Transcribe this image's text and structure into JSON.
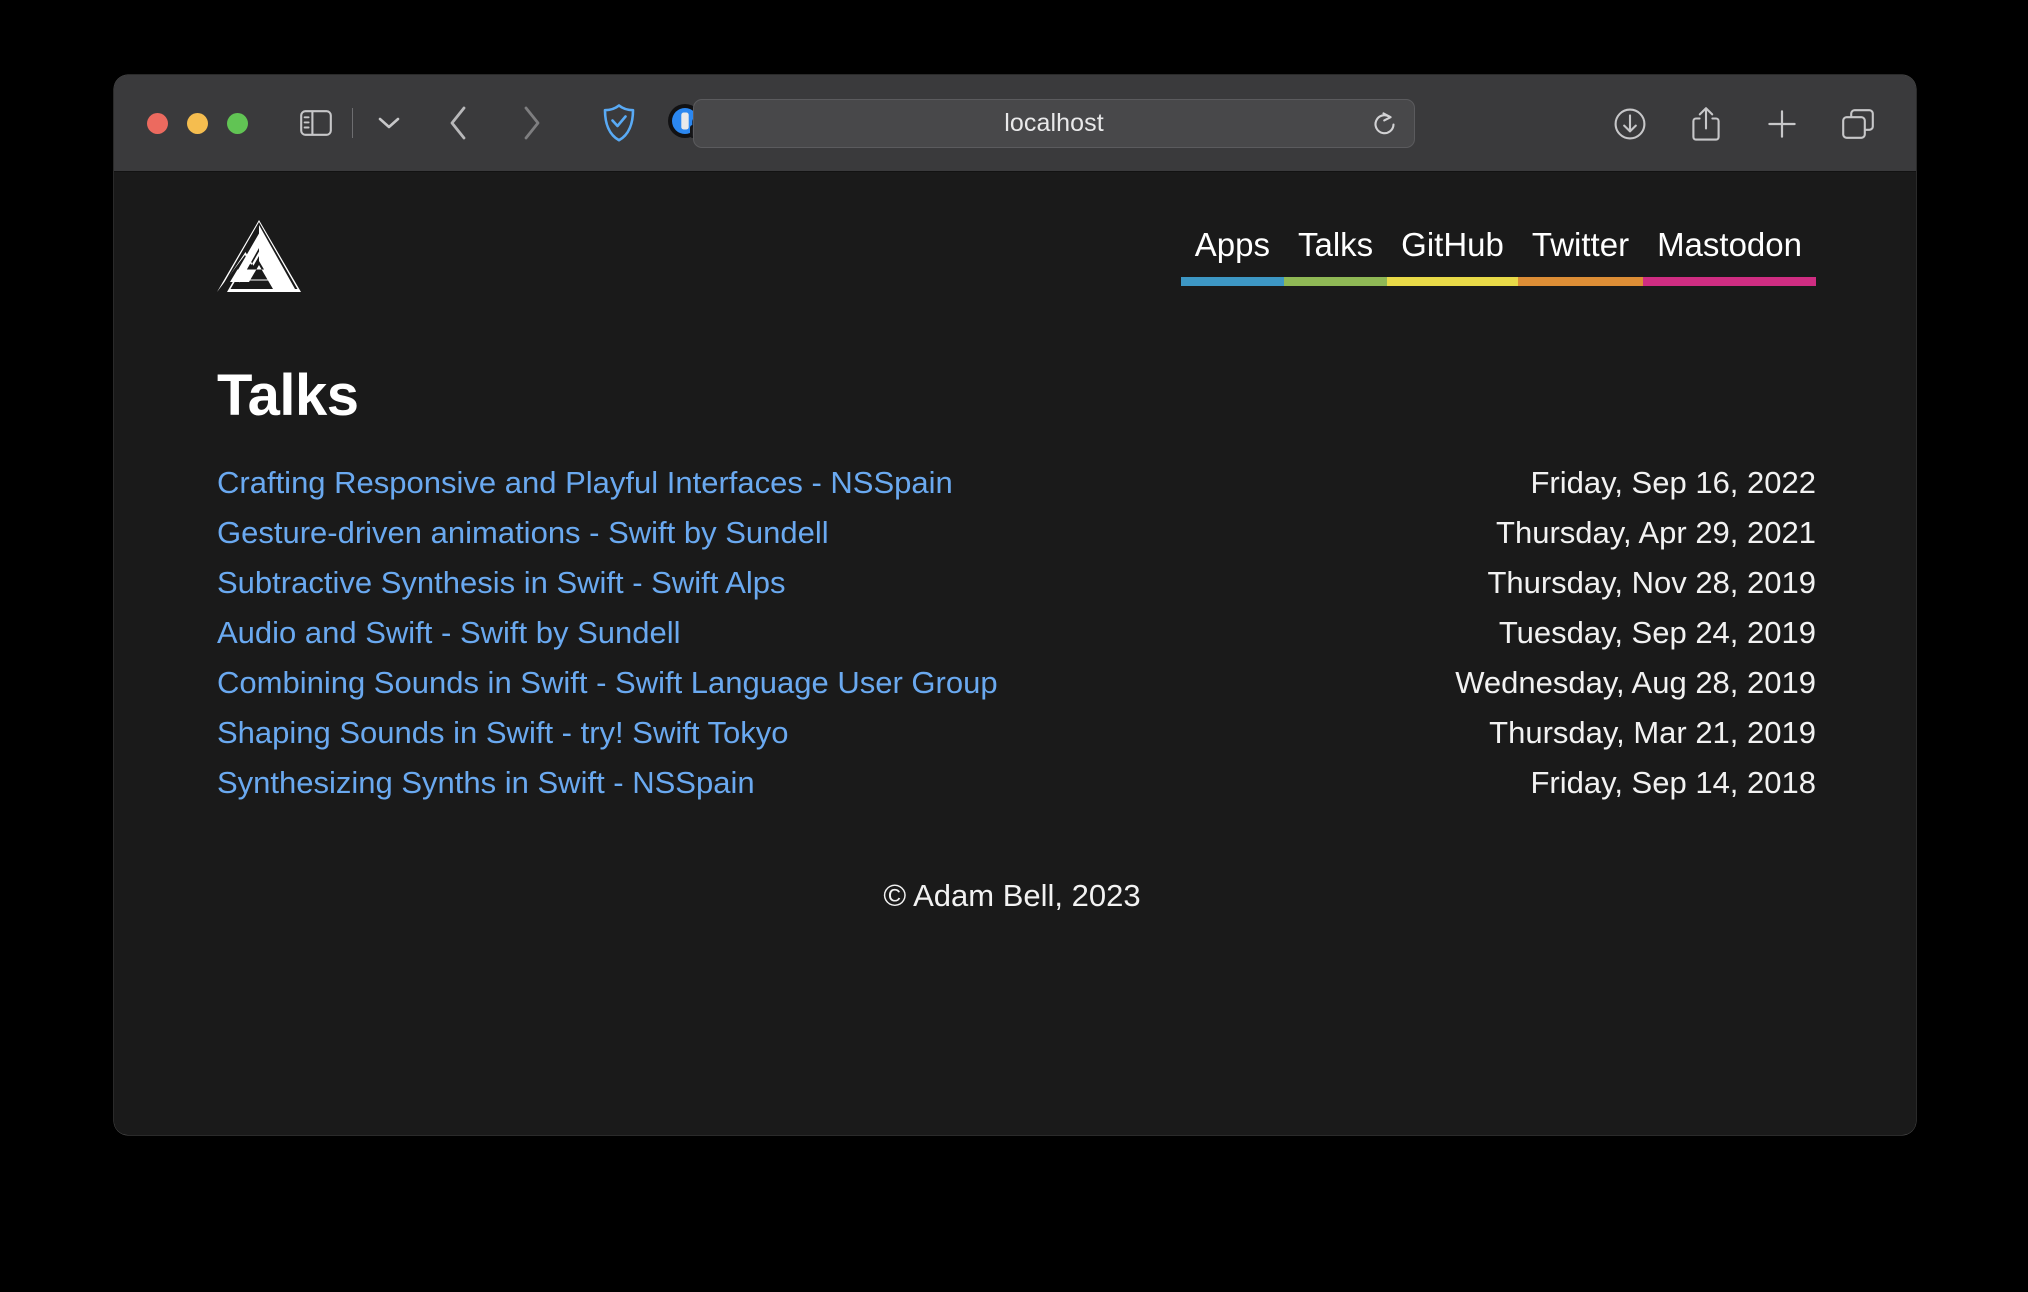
{
  "browser": {
    "name": "safari",
    "url_value": "localhost",
    "url_placeholder": "Search or enter website name",
    "traffic_lights": [
      {
        "name": "close",
        "color": "#ec6a5f"
      },
      {
        "name": "minimize",
        "color": "#f5bd4f"
      },
      {
        "name": "maximize",
        "color": "#61c454"
      }
    ],
    "toolbar_icons": {
      "sidebar": "sidebar-icon",
      "sidebar_chevron": "chevron-down-icon",
      "back": "back-arrow-icon",
      "forward": "forward-arrow-icon",
      "shield": "privacy-shield-icon",
      "extension": "extension-lock-icon",
      "reload": "reload-icon",
      "downloads": "downloads-icon",
      "share": "share-icon",
      "new_tab": "plus-icon",
      "tab_overview": "tab-overview-icon"
    }
  },
  "site": {
    "logo": "triangle-a-logo",
    "nav": [
      {
        "label": "Apps",
        "color": "#3d97c4"
      },
      {
        "label": "Talks",
        "color": "#8fb855"
      },
      {
        "label": "GitHub",
        "color": "#e8da48"
      },
      {
        "label": "Twitter",
        "color": "#dd8e36"
      },
      {
        "label": "Mastodon",
        "color": "#cf2d82"
      }
    ],
    "page_title": "Talks",
    "talks": [
      {
        "title": "Crafting Responsive and Playful Interfaces - NSSpain",
        "date": "Friday, Sep 16, 2022"
      },
      {
        "title": "Gesture-driven animations - Swift by Sundell",
        "date": "Thursday, Apr 29, 2021"
      },
      {
        "title": "Subtractive Synthesis in Swift - Swift Alps",
        "date": "Thursday, Nov 28, 2019"
      },
      {
        "title": "Audio and Swift - Swift by Sundell",
        "date": "Tuesday, Sep 24, 2019"
      },
      {
        "title": "Combining Sounds in Swift - Swift Language User Group",
        "date": "Wednesday, Aug 28, 2019"
      },
      {
        "title": "Shaping Sounds in Swift - try! Swift Tokyo",
        "date": "Thursday, Mar 21, 2019"
      },
      {
        "title": "Synthesizing Synths in Swift - NSSpain",
        "date": "Friday, Sep 14, 2018"
      }
    ],
    "footer": "© Adam Bell, 2023",
    "link_color": "#6aa9f0",
    "background_color": "#1a1a1a"
  }
}
